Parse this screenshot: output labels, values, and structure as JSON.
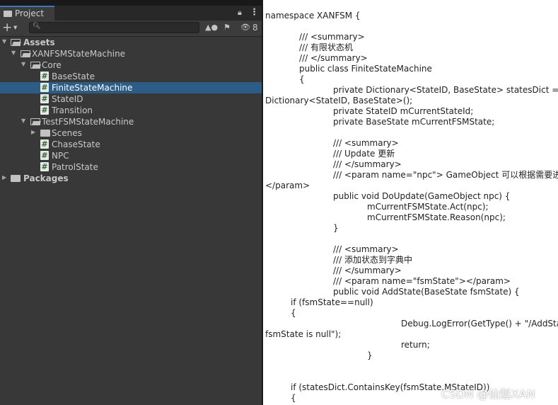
{
  "project_panel": {
    "tab_label": "Project",
    "hidden_count": "8",
    "search": {
      "value": "",
      "placeholder": ""
    },
    "tree": [
      {
        "label": "Assets",
        "kind": "folder-open",
        "bold": true
      },
      {
        "label": "XANFSMStateMachine",
        "kind": "folder-open"
      },
      {
        "label": "Core",
        "kind": "folder-open"
      },
      {
        "label": "BaseState",
        "kind": "script"
      },
      {
        "label": "FiniteStateMachine",
        "kind": "script",
        "selected": true
      },
      {
        "label": "StateID",
        "kind": "script"
      },
      {
        "label": "Transition",
        "kind": "script"
      },
      {
        "label": "TestFSMStateMachine",
        "kind": "folder-open"
      },
      {
        "label": "Scenes",
        "kind": "folder-closed"
      },
      {
        "label": "ChaseState",
        "kind": "script"
      },
      {
        "label": "NPC",
        "kind": "script"
      },
      {
        "label": "PatrolState",
        "kind": "script"
      },
      {
        "label": "Packages",
        "kind": "folder-closed",
        "bold": true
      }
    ]
  },
  "code_lines": [
    "namespace XANFSM {",
    "/// <summary>",
    "/// 有限状态机",
    "/// </summary>",
    "public class FiniteStateMachine",
    "{",
    "private Dictionary<StateID, BaseState> statesDict = new",
    "Dictionary<StateID, BaseState>();",
    "private StateID mCurrentStateId;",
    "private BaseState mCurrentFSMState;",
    "/// <summary>",
    "/// Update 更新",
    "/// </summary>",
    "/// <param name=\"npc\"> GameObject 可以根据需要进行更",
    "</param>",
    "public void DoUpdate(GameObject npc) {",
    "mCurrentFSMState.Act(npc);",
    "mCurrentFSMState.Reason(npc);",
    "}",
    "/// <summary>",
    "/// 添加状态到字典中",
    "/// </summary>",
    "/// <param name=\"fsmState\"></param>",
    "public void AddState(BaseState fsmState) {",
    "if (fsmState==null)",
    "{",
    "Debug.LogError(GetType() + \"/AddState",
    "fsmState is null\");",
    "return;",
    "}",
    "if (statesDict.ContainsKey(fsmState.MStateID))",
    "{"
  ],
  "watermark": "CSDN @仙魁XAN",
  "colors": {
    "selection": "#2c5d87",
    "tab_accent": "#3a79bb",
    "panel_bg": "#383838",
    "editor_bg": "#ffffff"
  }
}
